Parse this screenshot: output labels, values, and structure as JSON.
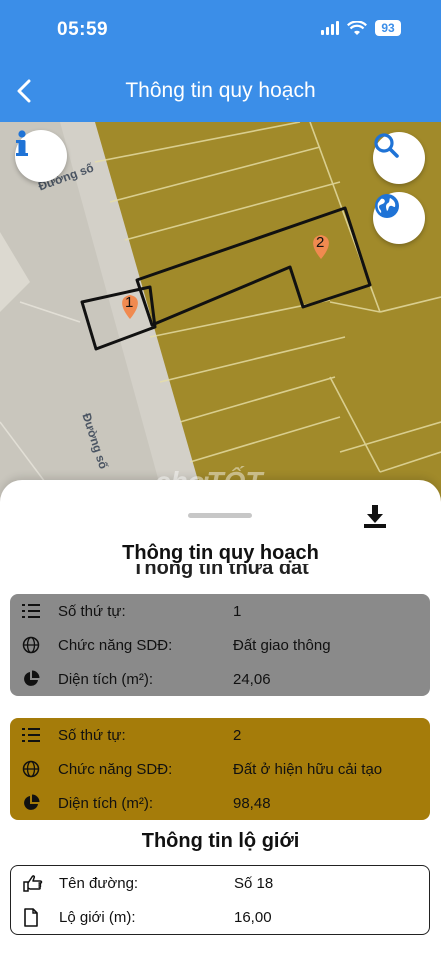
{
  "status_bar": {
    "time": "05:59",
    "battery": "93"
  },
  "header": {
    "title": "Thông tin quy hoạch"
  },
  "map": {
    "street_labels": [
      "Đường số",
      "Đường số"
    ],
    "plot_markers": [
      "1",
      "2"
    ],
    "watermark": "chợTỐT",
    "colors": {
      "residential": "#a18a2a",
      "road": "#c9c6bd",
      "plot_outline": "#111111",
      "marker": "#f08a50"
    }
  },
  "sheet": {
    "title": "Thông tin quy hoạch",
    "subtitle": "Thông tin thửa đất",
    "plots": [
      {
        "color": "#8a8a8a",
        "rows": [
          {
            "icon": "list-number-icon",
            "label": "Số thứ tự:",
            "value": "1"
          },
          {
            "icon": "globe-icon",
            "label": "Chức năng SDĐ:",
            "value": "Đất giao thông"
          },
          {
            "icon": "pie-chart-icon",
            "label": "Diện tích (m²):",
            "value": "24,06"
          }
        ]
      },
      {
        "color": "#a57c0a",
        "rows": [
          {
            "icon": "list-number-icon",
            "label": "Số thứ tự:",
            "value": "2"
          },
          {
            "icon": "globe-icon",
            "label": "Chức năng SDĐ:",
            "value": "Đất ở hiện hữu cải tạo"
          },
          {
            "icon": "pie-chart-icon",
            "label": "Diện tích (m²):",
            "value": "98,48"
          }
        ]
      }
    ],
    "road_section": {
      "title": "Thông tin lộ giới",
      "rows": [
        {
          "icon": "hand-pointer-icon",
          "label": "Tên đường:",
          "value": "Số 18"
        },
        {
          "icon": "document-icon",
          "label": "Lộ giới (m):",
          "value": "16,00"
        }
      ]
    }
  }
}
